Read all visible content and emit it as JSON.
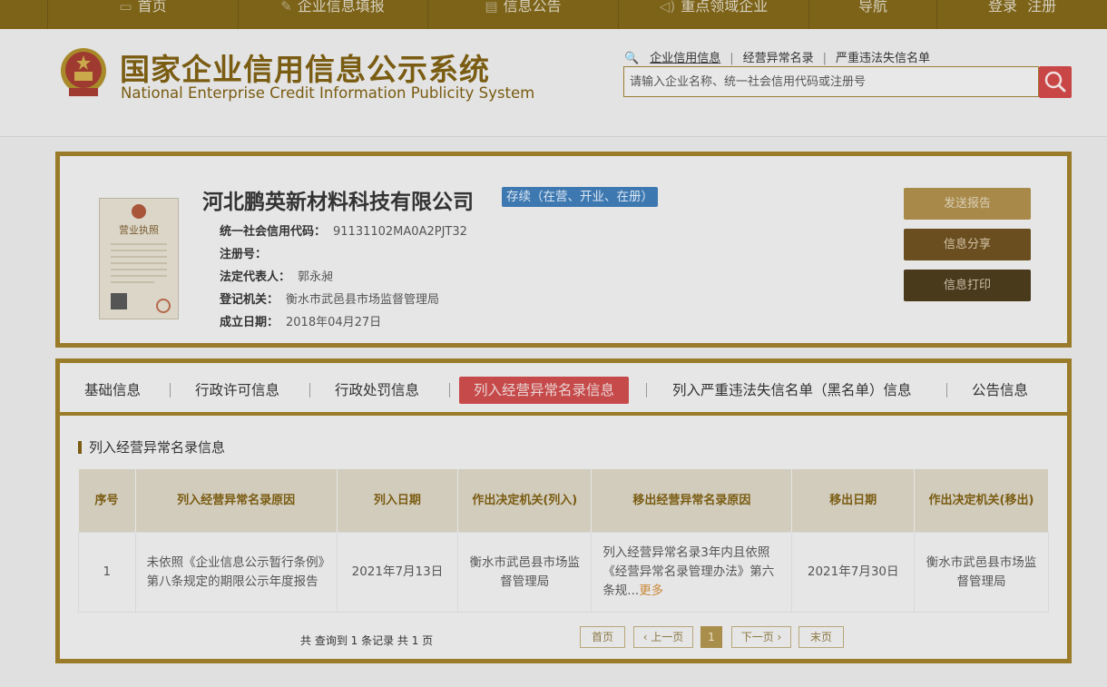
{
  "nav": {
    "items": [
      {
        "label": "首页",
        "icon": "monitor-icon"
      },
      {
        "label": "企业信息填报",
        "icon": "pen-icon"
      },
      {
        "label": "信息公告",
        "icon": "document-icon"
      },
      {
        "label": "重点领域企业",
        "icon": "speaker-icon"
      },
      {
        "label": "导航",
        "icon": ""
      }
    ],
    "login": "登录",
    "register": "注册"
  },
  "header": {
    "title_cn": "国家企业信用信息公示系统",
    "title_en": "National Enterprise Credit Information Publicity System",
    "search_links": [
      "企业信用信息",
      "经营异常名录",
      "严重违法失信名单"
    ],
    "search_placeholder": "请输入企业名称、统一社会信用代码或注册号"
  },
  "company": {
    "name": "河北鹏英新材料科技有限公司",
    "status": "存续（在营、开业、在册）",
    "fields": [
      {
        "key": "统一社会信用代码：",
        "value": "91131102MA0A2PJT32"
      },
      {
        "key": "注册号：",
        "value": ""
      },
      {
        "key": "法定代表人：",
        "value": "郭永昶"
      },
      {
        "key": "登记机关：",
        "value": "衡水市武邑县市场监督管理局"
      },
      {
        "key": "成立日期：",
        "value": "2018年04月27日"
      }
    ],
    "license_label": "营业执照",
    "buttons": {
      "send": "发送报告",
      "share": "信息分享",
      "print": "信息打印"
    }
  },
  "tabs": [
    "基础信息",
    "行政许可信息",
    "行政处罚信息",
    "列入经营异常名录信息",
    "列入严重违法失信名单（黑名单）信息",
    "公告信息"
  ],
  "section_title": "列入经营异常名录信息",
  "table": {
    "headers": [
      "序号",
      "列入经营异常名录原因",
      "列入日期",
      "作出决定机关(列入)",
      "移出经营异常名录原因",
      "移出日期",
      "作出决定机关(移出)"
    ],
    "rows": [
      {
        "no": "1",
        "reason_in": "未依照《企业信息公示暂行条例》第八条规定的期限公示年度报告",
        "date_in": "2021年7月13日",
        "org_in": "衡水市武邑县市场监督管理局",
        "reason_out": "列入经营异常名录3年内且依照《经营异常名录管理办法》第六条规...",
        "more": "更多",
        "date_out": "2021年7月30日",
        "org_out": "衡水市武邑县市场监督管理局"
      }
    ]
  },
  "footer": {
    "count_text": "共 查询到 1 条记录 共 1 页",
    "first": "首页",
    "prev": "‹ 上一页",
    "current": "1",
    "next": "下一页 ›",
    "last": "末页"
  },
  "colors": {
    "accent": "#9a7b29",
    "active_tab": "#c74a4a",
    "badge": "#3e78b0"
  }
}
